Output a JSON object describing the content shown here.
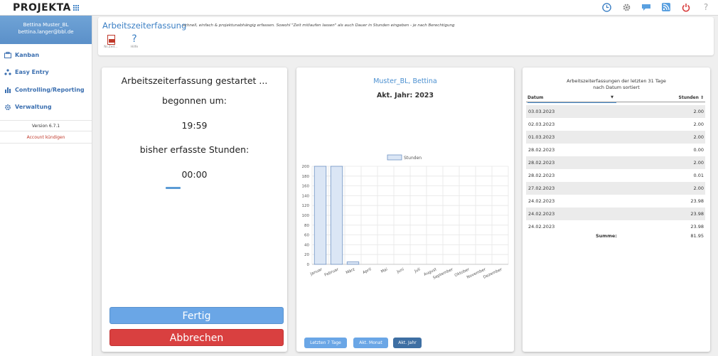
{
  "app": {
    "logo": "PROJEKTA"
  },
  "topbar": {
    "icons": [
      "clock-icon",
      "gear-icon",
      "chat-icon",
      "rss-icon",
      "power-icon",
      "help-icon"
    ]
  },
  "sidebar": {
    "user_name": "Bettina Muster_BL",
    "user_email": "bettina.langer@bbl.de",
    "items": [
      {
        "label": "Kanban",
        "icon": "kanban-icon"
      },
      {
        "label": "Easy Entry",
        "icon": "easy-entry-icon"
      },
      {
        "label": "Controlling/Reporting",
        "icon": "bar-chart-icon"
      },
      {
        "label": "Verwaltung",
        "icon": "gear-icon"
      }
    ],
    "version": "Version 6.7.1",
    "cancel_account": "Account kündigen"
  },
  "header": {
    "title": "Arbeitszeiterfassung",
    "description": "schnell, einfach & projektunabhängig erfassen. Sowohl \"Zeit mitlaufen lassen\" als auch Dauer in Stunden eingeben - je nach Berechtigung",
    "tools": [
      {
        "label": "Nr.Zeit..."
      },
      {
        "label": "Hilfe"
      }
    ]
  },
  "timer": {
    "status": "Arbeitszeiterfassung gestartet ...",
    "started_label": "begonnen um:",
    "started_time": "19:59",
    "hours_label": "bisher erfasste Stunden:",
    "hours_value": "00:00",
    "progress": 0.12,
    "done_button": "Fertig",
    "cancel_button": "Abbrechen"
  },
  "chart_panel": {
    "name": "Muster_BL, Bettina",
    "year_label": "Akt. Jahr: 2023",
    "buttons": [
      "Letzten 7 Tage",
      "Akt. Monat",
      "Akt. Jahr"
    ],
    "active_button": 2,
    "colors": {
      "bar_fill": "#dbe6f5",
      "bar_stroke": "#6f93c4",
      "button": "#6aa6e6",
      "button_active": "#3e6fa3"
    }
  },
  "chart_data": {
    "type": "bar",
    "categories": [
      "Januar",
      "Februar",
      "März",
      "April",
      "Mai",
      "Juni",
      "Juli",
      "August",
      "September",
      "Oktober",
      "November",
      "Dezember"
    ],
    "series": [
      {
        "name": "Stunden",
        "values": [
          200,
          200,
          5,
          0,
          0,
          0,
          0,
          0,
          0,
          0,
          0,
          0
        ]
      }
    ],
    "ylim": [
      0,
      200
    ],
    "yticks": [
      0,
      20,
      40,
      60,
      80,
      100,
      120,
      140,
      160,
      180,
      200
    ],
    "legend": "top-center",
    "grid": true
  },
  "list": {
    "title_line1": "Arbeitszeiterfassungen der letzten 31 Tage",
    "title_line2": "nach Datum sortiert",
    "col_date": "Datum",
    "col_hours": "Stunden ⇕",
    "rows": [
      {
        "date": "03.03.2023",
        "hours": "2.00"
      },
      {
        "date": "02.03.2023",
        "hours": "2.00"
      },
      {
        "date": "01.03.2023",
        "hours": "2.00"
      },
      {
        "date": "28.02.2023",
        "hours": "0.00"
      },
      {
        "date": "28.02.2023",
        "hours": "2.00"
      },
      {
        "date": "28.02.2023",
        "hours": "0.01"
      },
      {
        "date": "27.02.2023",
        "hours": "2.00"
      },
      {
        "date": "24.02.2023",
        "hours": "23.98"
      },
      {
        "date": "24.02.2023",
        "hours": "23.98"
      },
      {
        "date": "24.02.2023",
        "hours": "23.98"
      }
    ],
    "sum_label": "Summe:",
    "sum_value": "81.95"
  }
}
